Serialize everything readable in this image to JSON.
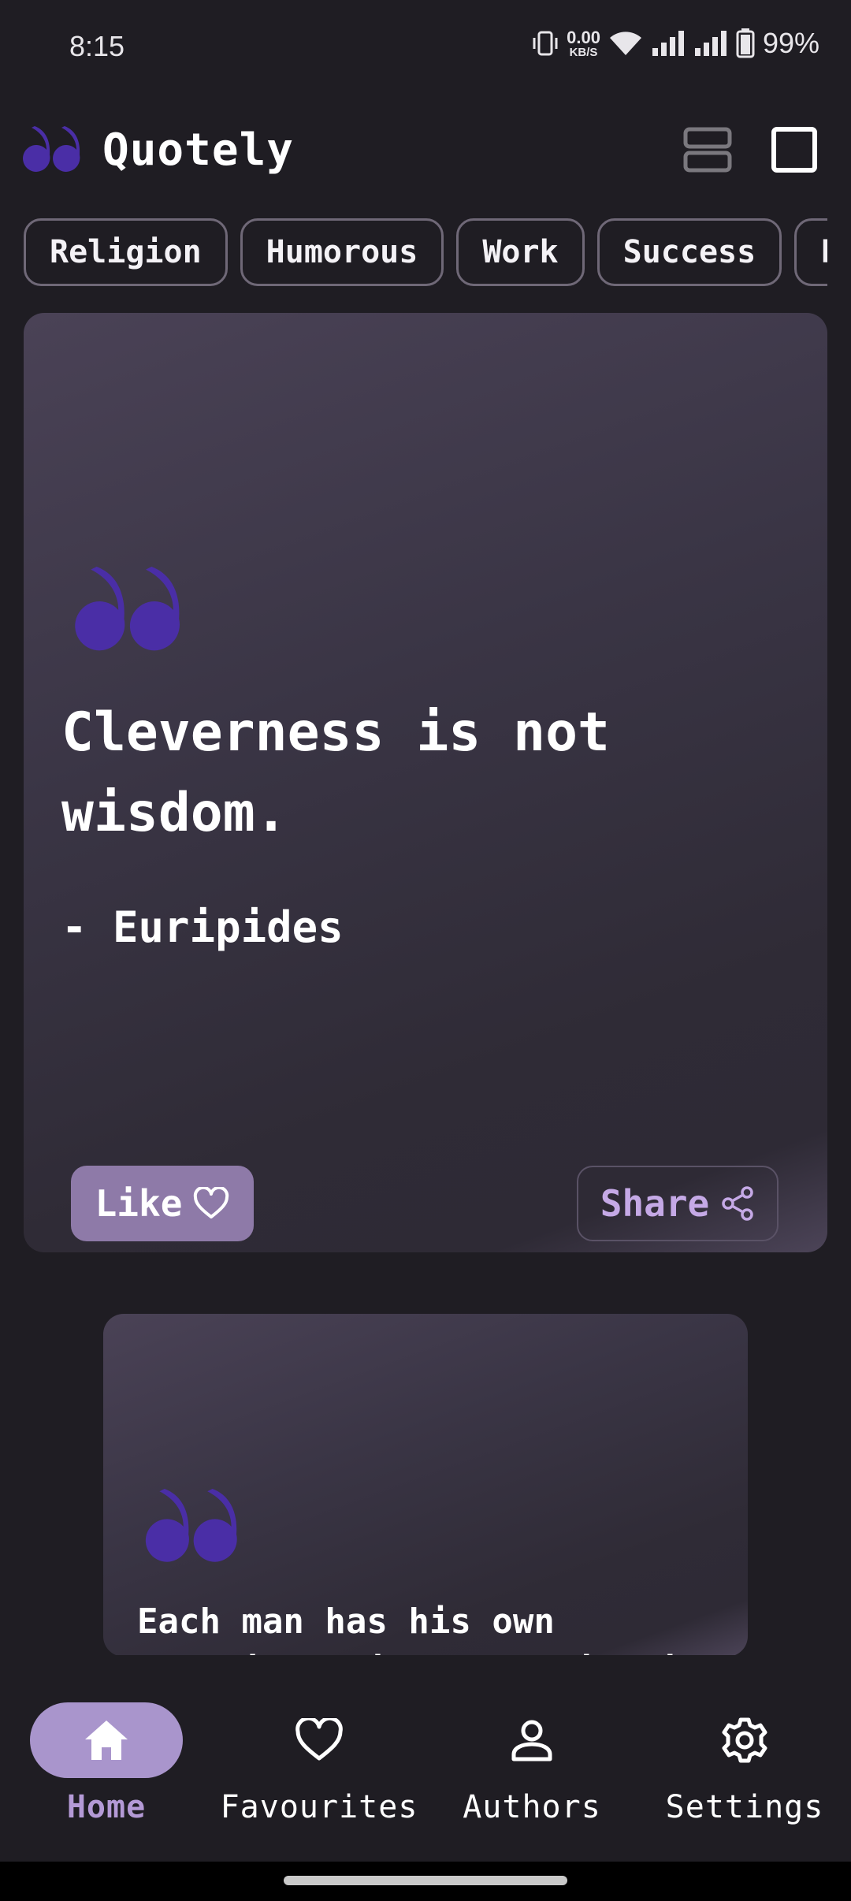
{
  "status_bar": {
    "time": "8:15",
    "net_speed_value": "0.00",
    "net_speed_unit": "KB/S",
    "battery_percent": "99%"
  },
  "app_bar": {
    "title": "Quotely",
    "logo_icon": "quote-mark-icon",
    "actions": [
      "layout-list-icon",
      "layout-single-icon"
    ]
  },
  "categories": [
    "Religion",
    "Humorous",
    "Work",
    "Success",
    "Fr"
  ],
  "cards": [
    {
      "quote": "Cleverness is not wisdom.",
      "author": "- Euripides",
      "like_label": "Like",
      "share_label": "Share"
    },
    {
      "quote": "Each man has his own vocation; his talent is his"
    }
  ],
  "bottom_nav": {
    "items": [
      {
        "label": "Home",
        "icon": "home-icon",
        "active": true
      },
      {
        "label": "Favourites",
        "icon": "heart-icon",
        "active": false
      },
      {
        "label": "Authors",
        "icon": "person-icon",
        "active": false
      },
      {
        "label": "Settings",
        "icon": "gear-icon",
        "active": false
      }
    ]
  },
  "colors": {
    "background": "#1f1d23",
    "accent": "#8e7aa8",
    "nav_active": "#a995cc",
    "quote_icon": "#4a2ea6",
    "share_text": "#c5a9e6"
  }
}
